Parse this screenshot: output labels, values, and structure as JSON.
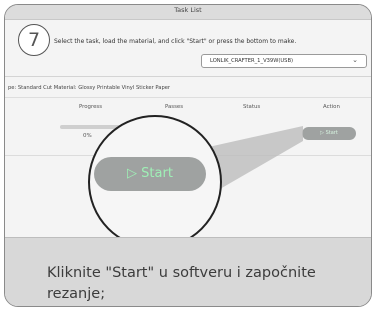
{
  "window": {
    "title": "Task List"
  },
  "step": {
    "number": "7"
  },
  "instruction": "Select the task, load the material, and click \"Start\" or press the bottom to make.",
  "device": {
    "selected": "LONLIK_CRAFTER_1_V39W(USB)",
    "icon": "chevron-down-icon"
  },
  "task": {
    "info": "pe: Standard Cut   Material: Glossy Printable Vinyl Sticker Paper"
  },
  "table": {
    "headers": [
      "Progress",
      "Passes",
      "Status",
      "Action"
    ],
    "row": {
      "progress_text": "0%",
      "progress": 0,
      "action_label": "▷ Start"
    }
  },
  "zoom": {
    "start_label": "▷ Start"
  },
  "caption": "Kliknite \"Start\" u softveru i započnite rezanje;",
  "colors": {
    "button": "#9fa2a1",
    "button_text": "#9ff0b6",
    "panel": "#d8d8d8"
  }
}
